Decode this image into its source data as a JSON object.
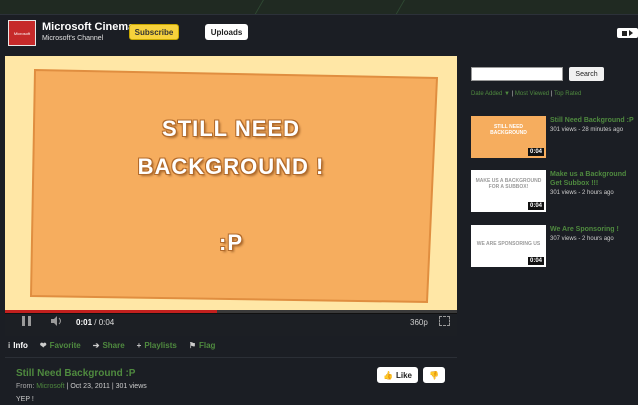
{
  "channel": {
    "logo_text": "Microsoft",
    "name": "Microsoft Cinema",
    "subtitle": "Microsoft's Channel",
    "subscribe_label": "Subscribe",
    "uploads_label": "Uploads"
  },
  "player": {
    "text_lines": [
      "STILL NEED",
      "BACKGROUND !",
      ":P"
    ],
    "current_time": "0:01",
    "time_separator": " / ",
    "duration": "0:04",
    "progress_fraction": 0.47,
    "quality": "360p"
  },
  "tabs": [
    {
      "label": "Info",
      "icon": "info-icon",
      "active": true
    },
    {
      "label": "Favorite",
      "icon": "heart-icon",
      "active": false
    },
    {
      "label": "Share",
      "icon": "share-arrow-icon",
      "active": false
    },
    {
      "label": "Playlists",
      "icon": "plus-icon",
      "active": false
    },
    {
      "label": "Flag",
      "icon": "flag-icon",
      "active": false
    }
  ],
  "video": {
    "title": "Still Need Background :P",
    "from_label": "From:",
    "author": "Microsoft",
    "date_text": " | Oct 23, 2011  | 301 views",
    "description": "YEP !",
    "like_label": "Like"
  },
  "sidebar": {
    "search_placeholder": "",
    "search_button": "Search",
    "sort_date": "Date Added",
    "sort_date_arrow": "▼",
    "sort_separator": " | ",
    "sort_viewed": "Most Viewed",
    "sort_rated": "Top Rated",
    "items": [
      {
        "title_lines": [
          "Still Need Background :P"
        ],
        "views": "301 views - 28 minutes ago",
        "duration": "0:04",
        "thumb_text": "STILL NEED BACKGROUND",
        "thumb_bg": "#f6ad5e",
        "thumb_fg": "#ffffff"
      },
      {
        "title_lines": [
          "Make us a Background",
          "Get Subbox !!!"
        ],
        "views": "301 views - 2 hours ago",
        "duration": "0:04",
        "thumb_text": "MAKE US A BACKGROUND FOR A SUBBOX!",
        "thumb_bg": "#ffffff",
        "thumb_fg": "#9a9a9a"
      },
      {
        "title_lines": [
          "We Are Sponsoring !"
        ],
        "views": "307 views - 2 hours ago",
        "duration": "0:04",
        "thumb_text": "WE ARE SPONSORING US",
        "thumb_bg": "#ffffff",
        "thumb_fg": "#9a9a9a"
      }
    ]
  },
  "colors": {
    "accent_green": "#4f8a3f",
    "subscribe_yellow": "#f7d23c",
    "progress_red": "#c2201e",
    "video_bg": "#ffe7a6",
    "card_orange": "#f6ad5e"
  }
}
